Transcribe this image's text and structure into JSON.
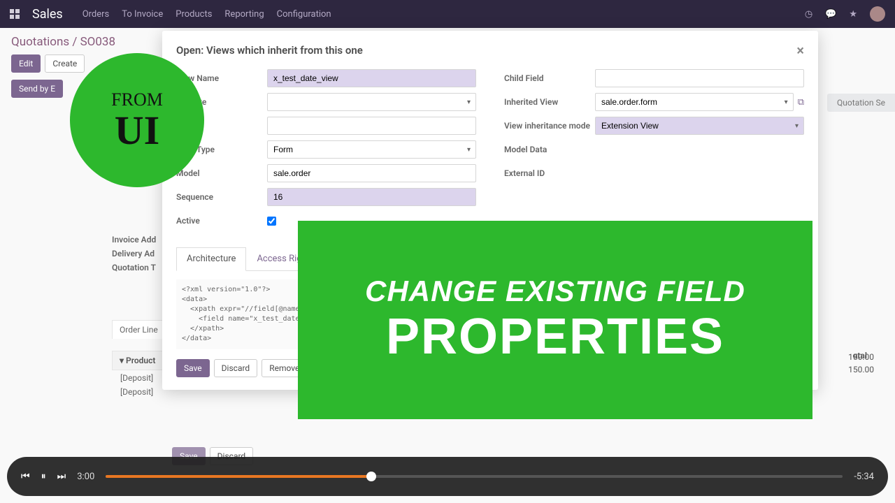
{
  "nav": {
    "brand": "Sales",
    "items": [
      "Orders",
      "To Invoice",
      "Products",
      "Reporting",
      "Configuration"
    ]
  },
  "breadcrumb": "Quotations / SO038",
  "buttons": {
    "edit": "Edit",
    "create": "Create",
    "send": "Send by E"
  },
  "right_chip": "Quotation Se",
  "bg": {
    "labels": [
      "Invoice Add",
      "Delivery Ad",
      "Quotation T"
    ],
    "order_tab": "Order Line",
    "product_header": "▾  Product",
    "rows": [
      "[Deposit]",
      "[Deposit]"
    ],
    "col_total": "otal",
    "amounts": [
      "150.00",
      "150.00"
    ]
  },
  "modal": {
    "title": "Open: Views which inherit from this one",
    "labels": {
      "view_name": "View Name",
      "website": "Website",
      "view_type": "View Type",
      "model": "Model",
      "sequence": "Sequence",
      "active": "Active",
      "child_field": "Child Field",
      "inherited_view": "Inherited View",
      "inherit_mode": "View inheritance mode",
      "model_data": "Model Data",
      "external_id": "External ID"
    },
    "values": {
      "view_name": "x_test_date_view",
      "view_type": "Form",
      "model": "sale.order",
      "sequence": "16",
      "inherited_view": "sale.order.form",
      "inherit_mode": "Extension View"
    },
    "tabs": [
      "Architecture",
      "Access Right"
    ],
    "code": "<?xml version=\"1.0\"?>\n<data>\n  <xpath expr=\"//field[@name='co\n    <field name=\"x_test_date\"/>\n  </xpath>\n</data>",
    "actions": {
      "save": "Save",
      "discard": "Discard",
      "remove": "Remove"
    }
  },
  "overlay": {
    "circle_l1": "FROM",
    "circle_l2": "UI",
    "rect_l1": "CHANGE EXISTING FIELD",
    "rect_l2": "PROPERTIES"
  },
  "bottom_actions": {
    "save": "Save",
    "discard": "Discard"
  },
  "player": {
    "elapsed": "3:00",
    "remaining": "-5:34"
  }
}
